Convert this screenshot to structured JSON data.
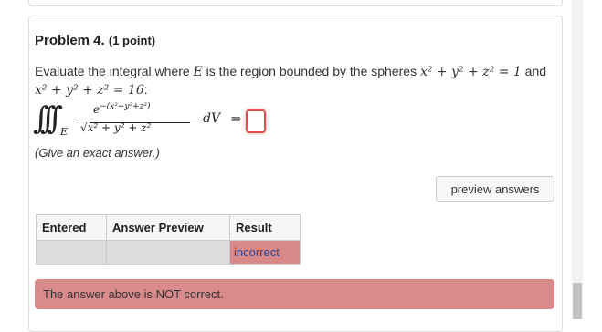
{
  "problem": {
    "title": "Problem 4.",
    "points": "(1 point)",
    "prompt_pre": "Evaluate the integral where ",
    "var_E": "E",
    "prompt_mid": " is the region bounded by the spheres ",
    "sphere1": "x² + y² + z² = 1",
    "prompt_and": " and",
    "sphere2": "x² + y² + z² = 16",
    "prompt_end": ":",
    "integral": {
      "signs": "∫∫∫",
      "region": "E",
      "numerator_base": "e",
      "numerator_exp": "−(x²+y²+z²)",
      "denominator": "√x² + y² + z²",
      "differential": "dV",
      "equals": "="
    },
    "hint": "(Give an exact answer.)"
  },
  "answer": {
    "value": ""
  },
  "buttons": {
    "preview": "preview answers"
  },
  "results_table": {
    "headers": [
      "Entered",
      "Answer Preview",
      "Result"
    ],
    "row": [
      "",
      "",
      "incorrect"
    ]
  },
  "alert": {
    "message": "The answer above is NOT correct."
  },
  "colors": {
    "error": "#d98b8c",
    "input_border": "#e05050",
    "link": "#2a4a9a"
  }
}
